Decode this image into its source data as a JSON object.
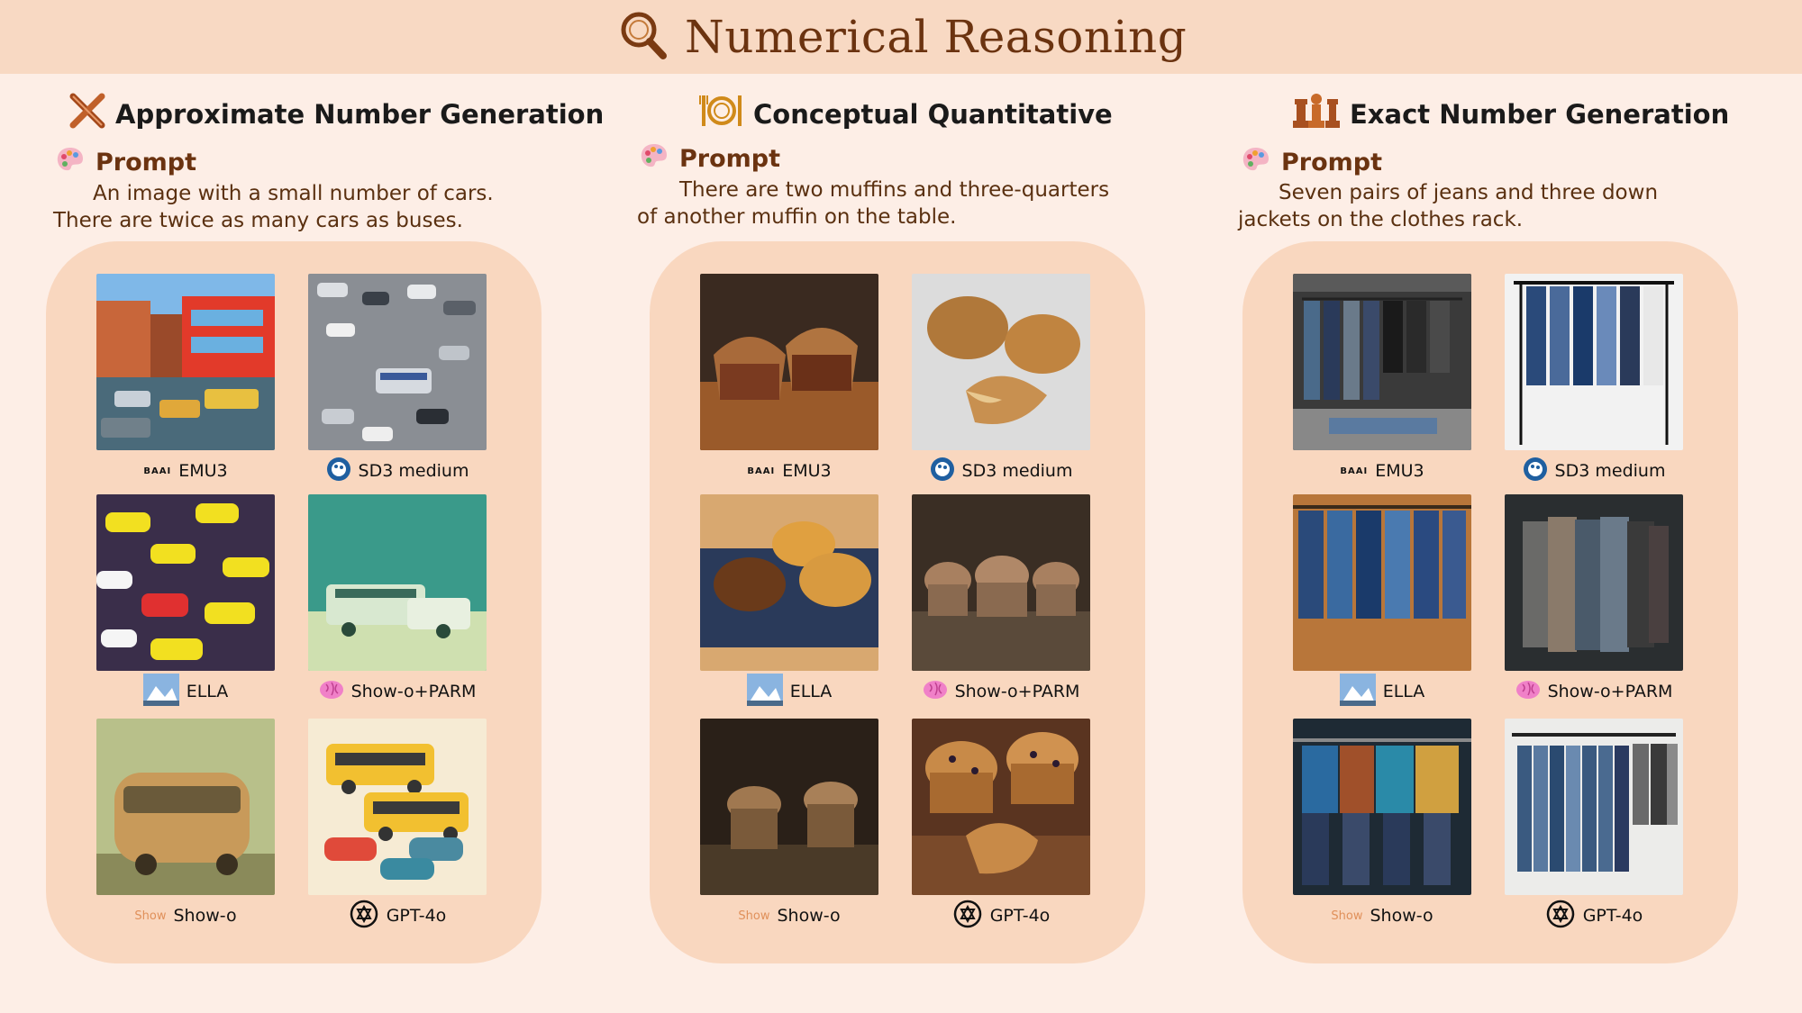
{
  "header": {
    "title": "Numerical Reasoning",
    "icon": "magnifier-icon"
  },
  "columns": [
    {
      "title": "Approximate Number Generation",
      "title_icon": "crossed-tools-icon",
      "prompt_label": "Prompt",
      "prompt_line1": "An image with a small number of cars.",
      "prompt_line2": "There are twice as many cars as buses.",
      "captions": [
        "EMU3",
        "SD3 medium",
        "ELLA",
        "Show-o+PARM",
        "Show-o",
        "GPT-4o"
      ]
    },
    {
      "title": "Conceptual Quantitative",
      "title_icon": "plate-cutlery-icon",
      "prompt_label": "Prompt",
      "prompt_line1": "There are two muffins and three-quarters",
      "prompt_line2": "of another muffin on the table.",
      "captions": [
        "EMU3",
        "SD3 medium",
        "ELLA",
        "Show-o+PARM",
        "Show-o",
        "GPT-4o"
      ]
    },
    {
      "title": "Exact Number Generation",
      "title_icon": "chess-pieces-icon",
      "prompt_label": "Prompt",
      "prompt_line1": "Seven pairs of jeans and three down",
      "prompt_line2": "jackets on the clothes rack.",
      "captions": [
        "EMU3",
        "SD3 medium",
        "ELLA",
        "Show-o+PARM",
        "Show-o",
        "GPT-4o"
      ]
    }
  ],
  "logos": {
    "emu3": "BAAI",
    "showo": "Show"
  },
  "colors": {
    "background": "#fdeee6",
    "header": "#f8d9c3",
    "panel": "#f9d7bf",
    "title_brown": "#6b3310"
  }
}
